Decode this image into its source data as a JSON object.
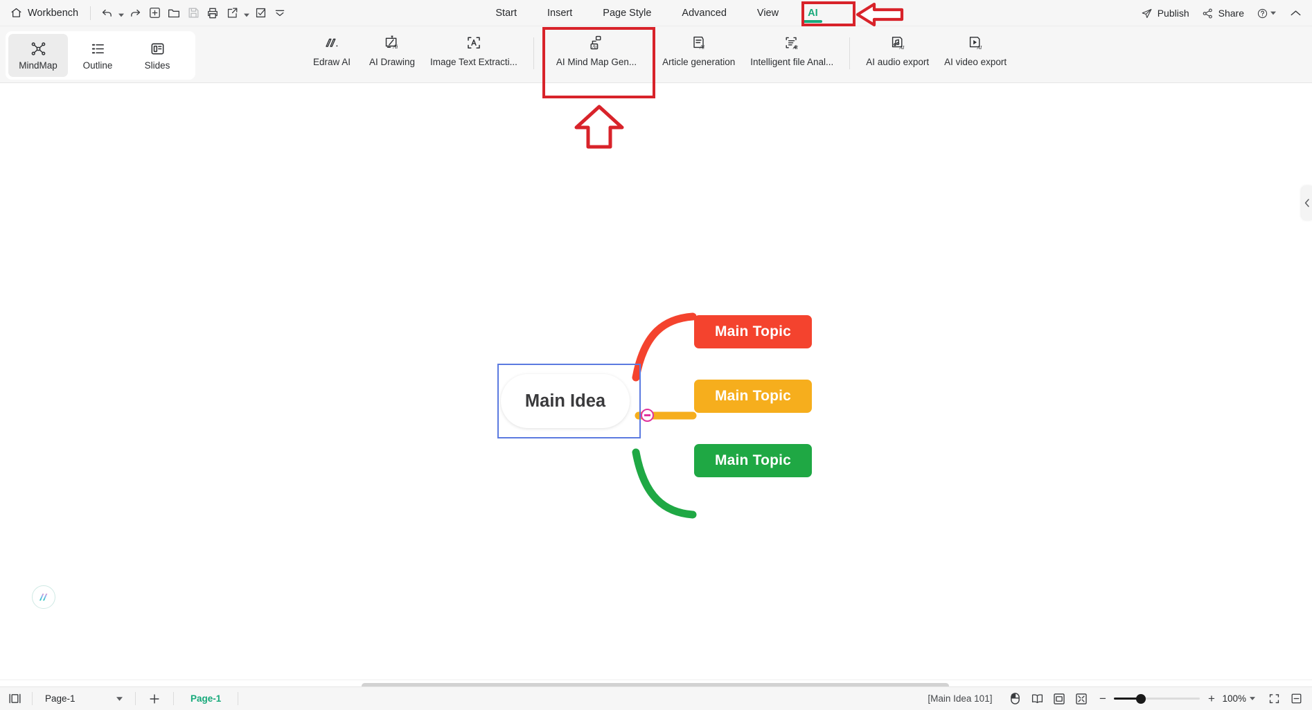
{
  "app": {
    "home_label": "Workbench",
    "quick_access": [
      {
        "name": "undo-icon",
        "label": "Undo"
      },
      {
        "name": "redo-icon",
        "label": "Redo"
      },
      {
        "name": "new-icon",
        "label": "New"
      },
      {
        "name": "open-icon",
        "label": "Open"
      },
      {
        "name": "save-icon",
        "label": "Save"
      },
      {
        "name": "print-icon",
        "label": "Print"
      },
      {
        "name": "export-icon",
        "label": "Export"
      },
      {
        "name": "select-icon",
        "label": "Select"
      },
      {
        "name": "more-icon",
        "label": "More"
      }
    ]
  },
  "menu": {
    "tabs": [
      {
        "label": "Start",
        "active": false
      },
      {
        "label": "Insert",
        "active": false
      },
      {
        "label": "Page Style",
        "active": false
      },
      {
        "label": "Advanced",
        "active": false
      },
      {
        "label": "View",
        "active": false
      },
      {
        "label": "AI",
        "active": true
      }
    ],
    "active_tab": "AI",
    "active_color": "#16a97a"
  },
  "header_right": {
    "publish_label": "Publish",
    "share_label": "Share",
    "help_label": "?",
    "collapse_label": "Collapse ribbon"
  },
  "ribbon": {
    "view_modes": [
      {
        "label": "MindMap",
        "icon": "mindmap-icon",
        "active": true
      },
      {
        "label": "Outline",
        "icon": "outline-icon",
        "active": false
      },
      {
        "label": "Slides",
        "icon": "slides-icon",
        "active": false
      }
    ],
    "ai_tools": [
      {
        "label": "Edraw AI",
        "icon": "edraw-ai-icon",
        "highlighted": false
      },
      {
        "label": "AI Drawing",
        "icon": "ai-drawing-icon",
        "highlighted": false
      },
      {
        "label": "Image Text Extracti...",
        "icon": "image-text-extraction-icon",
        "highlighted": false
      },
      {
        "label": "AI Mind Map Gen...",
        "icon": "ai-mindmap-generate-icon",
        "highlighted": true
      },
      {
        "label": "Article generation",
        "icon": "article-generation-icon",
        "highlighted": false
      },
      {
        "label": "Intelligent file Anal...",
        "icon": "intelligent-file-analysis-icon",
        "highlighted": false
      },
      {
        "label": "AI audio export",
        "icon": "ai-audio-export-icon",
        "highlighted": false
      },
      {
        "label": "AI video export",
        "icon": "ai-video-export-icon",
        "highlighted": false
      }
    ]
  },
  "annotations": {
    "highlight_color": "#d8232a",
    "boxes": [
      {
        "name": "ai-tab-highlight",
        "target": "AI"
      },
      {
        "name": "ai-mindmap-button-highlight",
        "target": "AI Mind Map Gen..."
      }
    ],
    "arrows": [
      {
        "name": "ai-tab-arrow",
        "direction": "left"
      },
      {
        "name": "ai-mindmap-arrow",
        "direction": "up"
      }
    ]
  },
  "mindmap": {
    "center": {
      "label": "Main Idea",
      "selected": true,
      "border_color": "#5b7ae0"
    },
    "branches": [
      {
        "label": "Main Topic",
        "color": "#f4432e"
      },
      {
        "label": "Main Topic",
        "color": "#f6ae1d"
      },
      {
        "label": "Main Topic",
        "color": "#1fa844"
      }
    ],
    "collapse_control": {
      "name": "collapse-toggle",
      "color": "#e0349c",
      "state": "expanded"
    }
  },
  "statusbar": {
    "view_toggle_label": "Toggle panel",
    "page_select_value": "Page-1",
    "add_page_label": "+",
    "page_tab_label": "Page-1",
    "object_info": "[Main Idea 101]",
    "zoom_value": "100%",
    "zoom_minus": "−",
    "zoom_plus": "+",
    "right_icons": [
      {
        "name": "mouse-mode-icon",
        "label": "Mouse mode"
      },
      {
        "name": "page-view-icon",
        "label": "Page view"
      },
      {
        "name": "fit-page-icon",
        "label": "Fit page"
      },
      {
        "name": "fit-width-icon",
        "label": "Fit to screen"
      },
      {
        "name": "fullscreen-icon",
        "label": "Full screen"
      },
      {
        "name": "presentation-icon",
        "label": "Presentation"
      }
    ]
  }
}
